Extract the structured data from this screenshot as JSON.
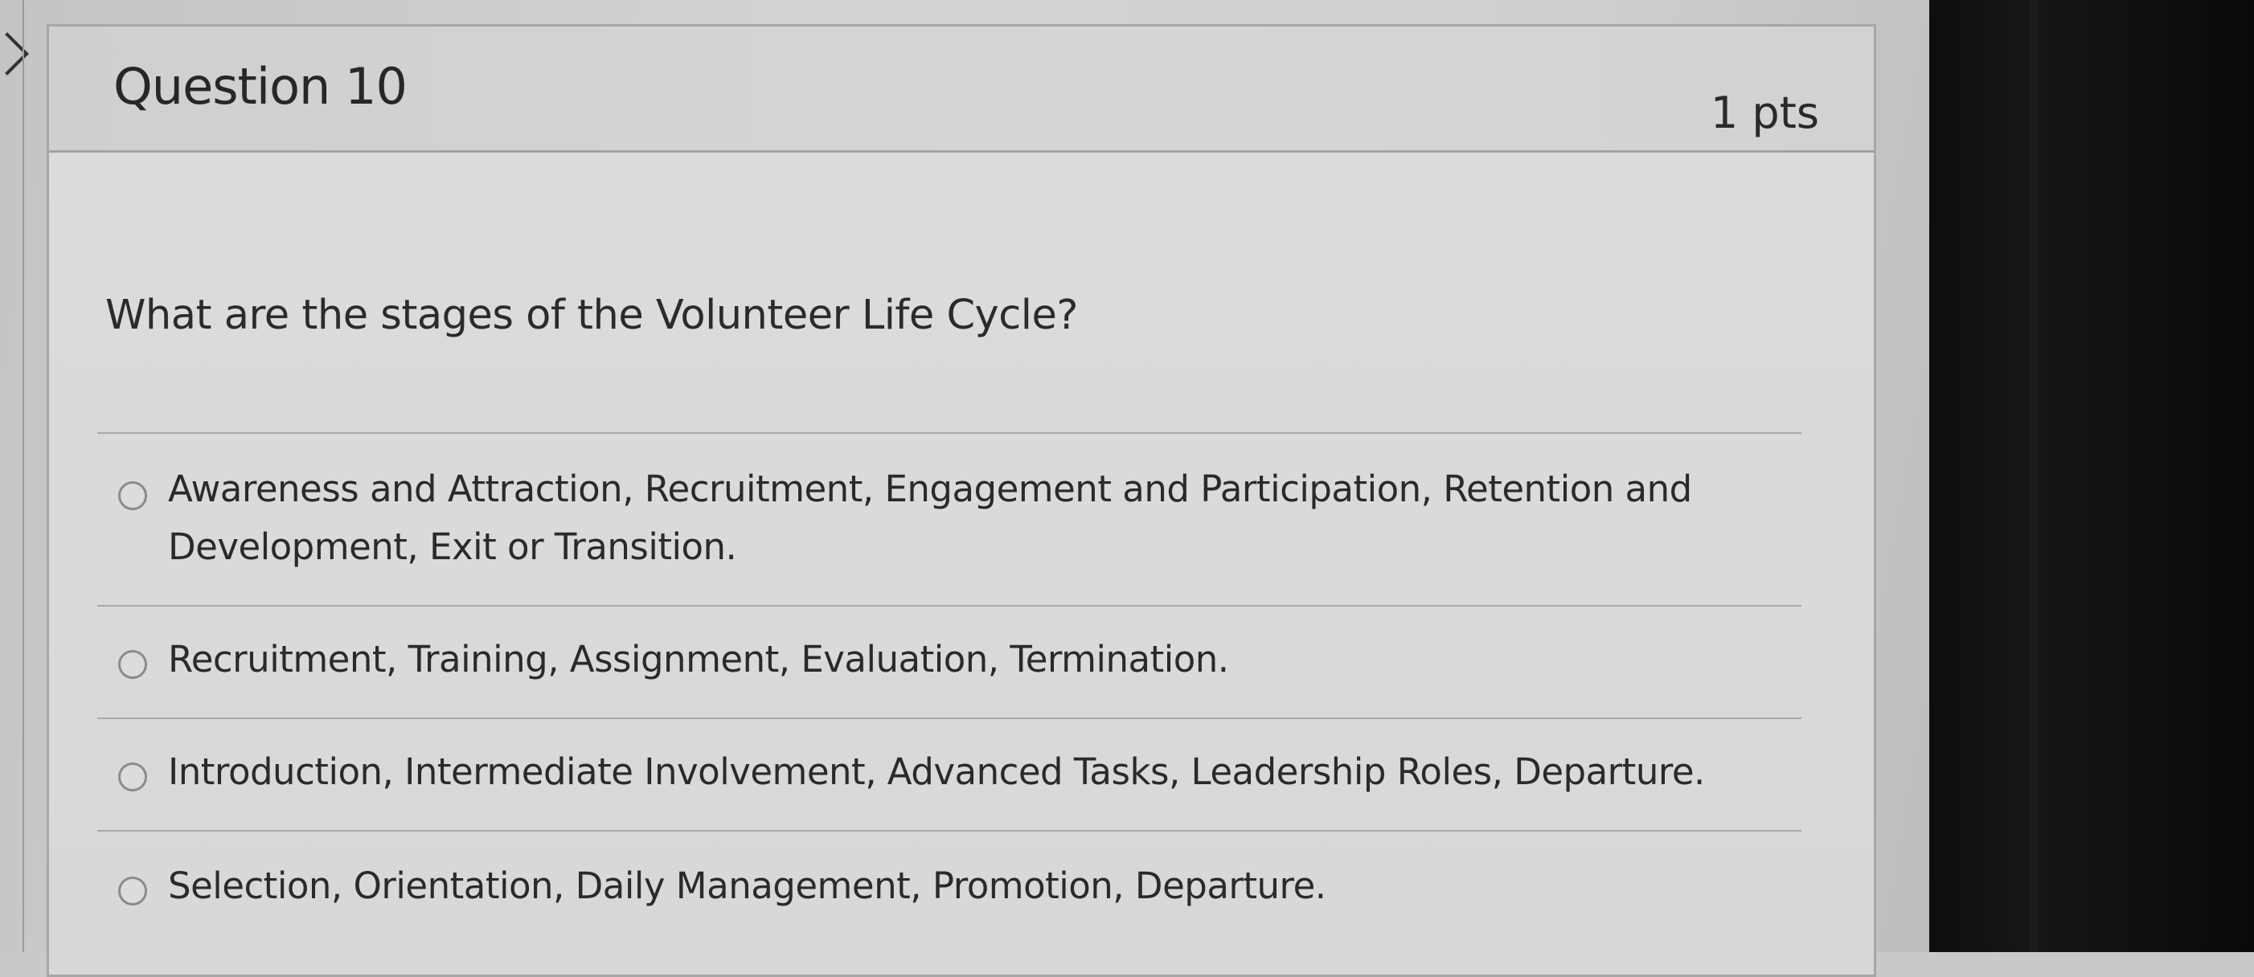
{
  "question": {
    "title": "Question 10",
    "points": "1 pts",
    "text": "What are the stages of the Volunteer Life Cycle?"
  },
  "answers": [
    {
      "label": "Awareness and Attraction, Recruitment, Engagement and Participation, Retention and Development, Exit or Transition."
    },
    {
      "label": "Recruitment, Training, Assignment, Evaluation, Termination."
    },
    {
      "label": "Introduction, Intermediate Involvement, Advanced Tasks, Leadership Roles, Departure."
    },
    {
      "label": "Selection, Orientation, Daily Management, Promotion, Departure."
    }
  ]
}
